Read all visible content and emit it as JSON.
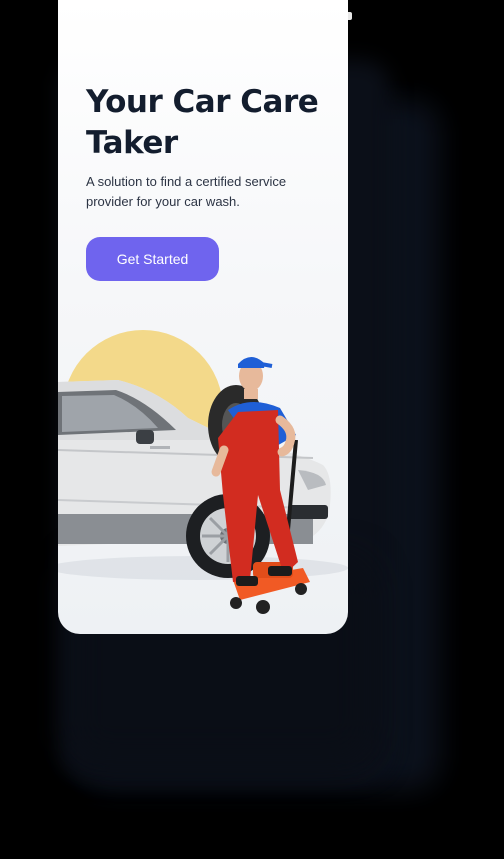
{
  "screen": {
    "title": "Your Car Care Taker",
    "subtitle": "A solution to find a certified service provider for your car wash.",
    "cta_label": "Get Started"
  },
  "colors": {
    "background": "#000000",
    "screen_bg": "#ffffff",
    "title": "#131d2e",
    "button": "#6f64ee",
    "sun_accent": "#f3d98a",
    "car_body": "#e6e7e8",
    "overalls": "#d22c20",
    "shirt": "#1f5fd6",
    "jack": "#f15a24"
  },
  "illustration": {
    "icons": [
      "sun-shape",
      "car-illustration",
      "mechanic-illustration",
      "floor-jack-illustration",
      "tire-illustration"
    ]
  }
}
